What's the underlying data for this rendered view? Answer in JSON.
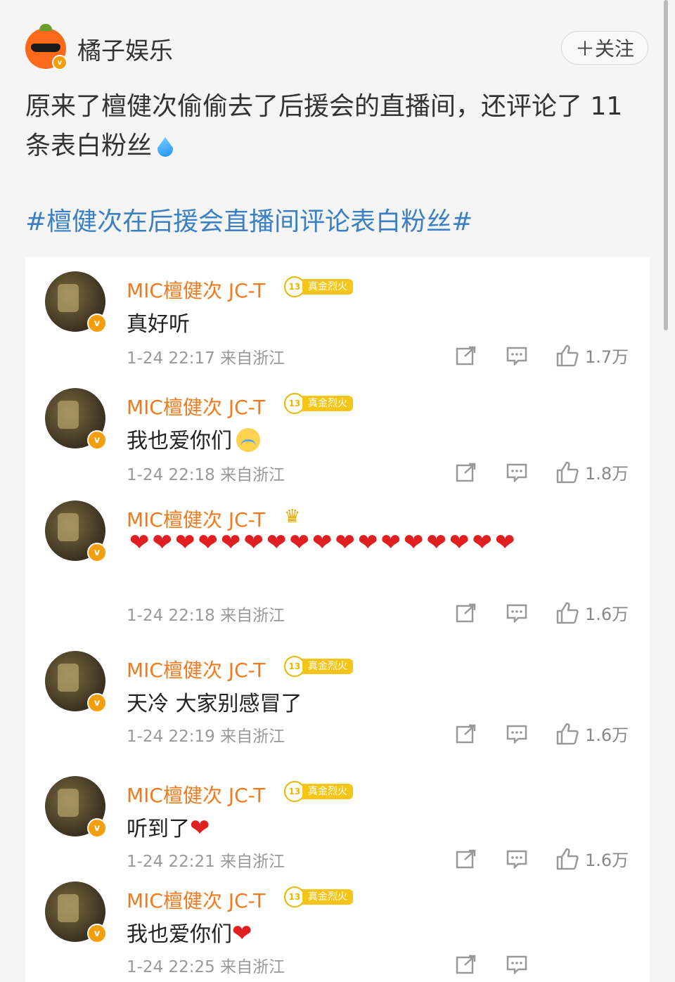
{
  "author": {
    "name": "橘子娱乐",
    "follow_label": "＋关注",
    "verified_icon": "v-badge-icon"
  },
  "post": {
    "text": "原来了檀健次偷偷去了后援会的直播间，还评论了 11 条表白粉丝",
    "emoji": "droplet-icon",
    "hashtag": "#檀健次在后援会直播间评论表白粉丝#"
  },
  "comments": [
    {
      "name": "MIC檀健次 JC-T",
      "level": "13",
      "tag": "真金烈火",
      "text": "真好听",
      "emoji": "",
      "time": "1-24 22:17",
      "location": "来自浙江",
      "likes": "1.7万"
    },
    {
      "name": "MIC檀健次 JC-T",
      "level": "13",
      "tag": "真金烈火",
      "text": "我也爱你们",
      "emoji": "crying-face-icon",
      "time": "1-24 22:18",
      "location": "来自浙江",
      "likes": "1.8万"
    },
    {
      "name": "MIC檀健次 JC-T",
      "level": "",
      "tag": "",
      "text": "",
      "emoji": "heart-icon",
      "heart_count": 17,
      "time": "1-24 22:18",
      "location": "来自浙江",
      "likes": "1.6万"
    },
    {
      "name": "MIC檀健次 JC-T",
      "level": "13",
      "tag": "真金烈火",
      "text": "天冷 大家别感冒了",
      "emoji": "",
      "time": "1-24 22:19",
      "location": "来自浙江",
      "likes": "1.6万"
    },
    {
      "name": "MIC檀健次 JC-T",
      "level": "13",
      "tag": "真金烈火",
      "text": "听到了",
      "emoji": "heart-icon",
      "time": "1-24 22:21",
      "location": "来自浙江",
      "likes": "1.6万"
    },
    {
      "name": "MIC檀健次 JC-T",
      "level": "13",
      "tag": "真金烈火",
      "text": "我也爱你们",
      "emoji": "heart-icon",
      "time": "1-24 22:25",
      "location": "来自浙江",
      "likes": ""
    }
  ],
  "colors": {
    "accent_orange": "#f07a1e",
    "hashtag_blue": "#3b7fc4",
    "heart_red": "#e02020",
    "badge_gold": "#f5c518"
  }
}
